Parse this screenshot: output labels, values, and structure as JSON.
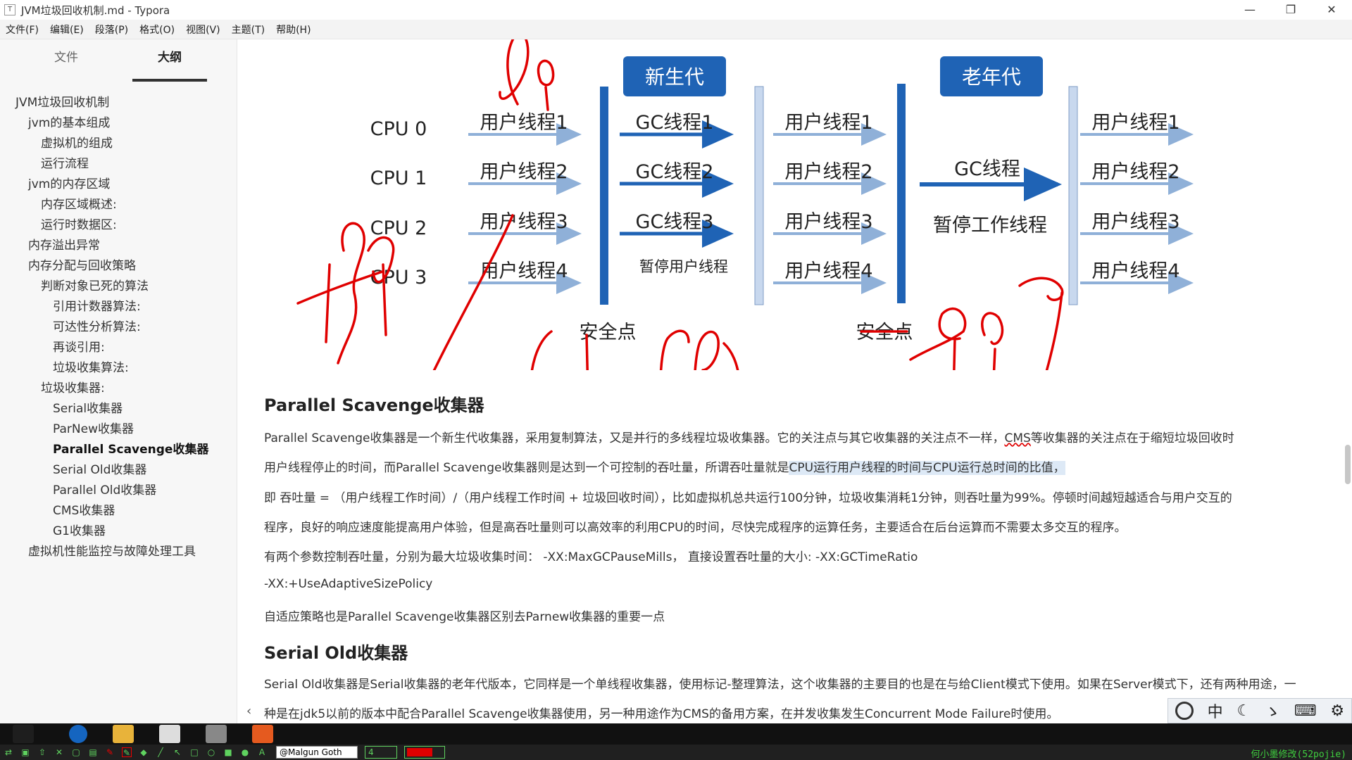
{
  "window": {
    "title": "JVM垃圾回收机制.md - Typora",
    "app_icon": "T"
  },
  "menu": [
    "文件(F)",
    "编辑(E)",
    "段落(P)",
    "格式(O)",
    "视图(V)",
    "主题(T)",
    "帮助(H)"
  ],
  "sidebar": {
    "tabs": [
      "文件",
      "大纲"
    ],
    "outline": [
      {
        "label": "JVM垃圾回收机制",
        "level": 1
      },
      {
        "label": "jvm的基本组成",
        "level": 2
      },
      {
        "label": "虚拟机的组成",
        "level": 3
      },
      {
        "label": "运行流程",
        "level": 3
      },
      {
        "label": "jvm的内存区域",
        "level": 2
      },
      {
        "label": "内存区域概述:",
        "level": 3
      },
      {
        "label": "运行时数据区:",
        "level": 3
      },
      {
        "label": "内存溢出异常",
        "level": 2
      },
      {
        "label": "内存分配与回收策略",
        "level": 2
      },
      {
        "label": "判断对象已死的算法",
        "level": 3
      },
      {
        "label": "引用计数器算法:",
        "level": 4
      },
      {
        "label": "可达性分析算法:",
        "level": 4
      },
      {
        "label": "再谈引用:",
        "level": 4
      },
      {
        "label": "垃圾收集算法:",
        "level": 4
      },
      {
        "label": "垃圾收集器:",
        "level": 3
      },
      {
        "label": "Serial收集器",
        "level": 4
      },
      {
        "label": "ParNew收集器",
        "level": 4
      },
      {
        "label": "Parallel Scavenge收集器",
        "level": 4,
        "active": true
      },
      {
        "label": "Serial Old收集器",
        "level": 4
      },
      {
        "label": "Parallel Old收集器",
        "level": 4
      },
      {
        "label": "CMS收集器",
        "level": 4
      },
      {
        "label": "G1收集器",
        "level": 4
      },
      {
        "label": "虚拟机性能监控与故障处理工具",
        "level": 2
      }
    ]
  },
  "diagram": {
    "young_label": "新生代",
    "old_label": "老年代",
    "cpus": [
      "CPU 0",
      "CPU 1",
      "CPU 2",
      "CPU 3"
    ],
    "user_threads": [
      "用户线程1",
      "用户线程2",
      "用户线程3",
      "用户线程4"
    ],
    "gc_threads": [
      "GC线程1",
      "GC线程2",
      "GC线程3"
    ],
    "pause_user": "暂停用户线程",
    "gc_thread": "GC线程",
    "pause_work": "暂停工作线程",
    "safepoint": "安全点",
    "accent": "#1f63b5"
  },
  "doc": {
    "h_parallel": "Parallel Scavenge收集器",
    "p1_a": "Parallel Scavenge收集器是一个新生代收集器，采用复制算法，又是并行的多线程垃圾收集器。它的关注点与其它收集器的关注点不一样，",
    "p1_cms": "CMS",
    "p1_b": "等收集器的关注点在于缩短垃圾回收时",
    "p2_a": "用户线程停止的时间，而Parallel Scavenge收集器则是达到一个可控制的吞吐量，所谓吞吐量就是",
    "p2_hl": "CPU运行用户线程的时间与CPU运行总时间的比值，",
    "p3": "即 吞吐量 = （用户线程工作时间）/（用户线程工作时间 + 垃圾回收时间），比如虚拟机总共运行100分钟，垃圾收集消耗1分钟，则吞吐量为99%。停顿时间越短越适合与用户交互的",
    "p4": "程序，良好的响应速度能提高用户体验，但是高吞吐量则可以高效率的利用CPU的时间，尽快完成程序的运算任务，主要适合在后台运算而不需要太多交互的程序。",
    "p5": "有两个参数控制吞吐量，分别为最大垃圾收集时间：  -XX:MaxGCPauseMills，  直接设置吞吐量的大小: -XX:GCTimeRatio",
    "p6": "-XX:+UseAdaptiveSizePolicy",
    "p7": "自适应策略也是Parallel Scavenge收集器区别去Parnew收集器的重要一点",
    "h_serial_old": "Serial Old收集器",
    "p8": "Serial Old收集器是Serial收集器的老年代版本，它同样是一个单线程收集器，使用标记-整理算法，这个收集器的主要目的也是在与给Client模式下使用。如果在Server模式下，还有两种用途，一",
    "p9": "种是在jdk5以前的版本中配合Parallel Scavenge收集器使用，另一种用途作为CMS的备用方案，在并发收集发生Concurrent Mode Failure时使用。"
  },
  "ime": [
    "中",
    "ゝ",
    "⌨",
    "⚙"
  ],
  "drawing_toolbar": {
    "font": "@Malgun Goth",
    "size": "4",
    "color": "#e00000",
    "credit": "何小墨修改(52pojie)"
  }
}
